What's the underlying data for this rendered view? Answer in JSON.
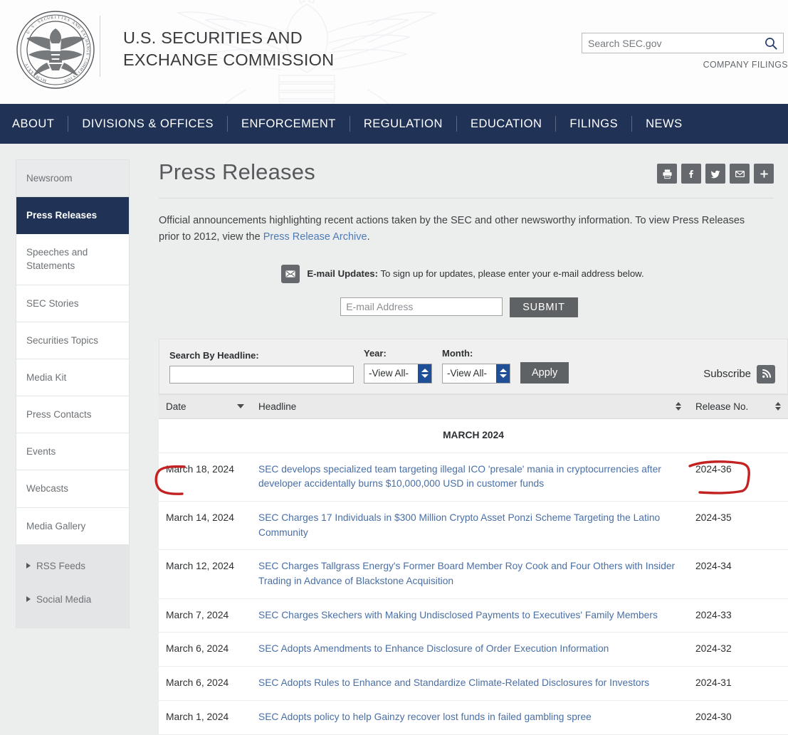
{
  "header": {
    "agency_name_line1": "U.S. SECURITIES AND",
    "agency_name_line2": "EXCHANGE COMMISSION",
    "seal_icon": "sec-seal-icon",
    "watermark_icon": "eagle-watermark-icon",
    "search": {
      "placeholder": "Search SEC.gov",
      "value": "",
      "icon": "search-icon"
    },
    "company_filings_label": "COMPANY FILINGS"
  },
  "nav": {
    "items": [
      {
        "label": "ABOUT"
      },
      {
        "label": "DIVISIONS & OFFICES"
      },
      {
        "label": "ENFORCEMENT"
      },
      {
        "label": "REGULATION"
      },
      {
        "label": "EDUCATION"
      },
      {
        "label": "FILINGS"
      },
      {
        "label": "NEWS"
      }
    ]
  },
  "sidebar": {
    "items": [
      {
        "label": "Newsroom",
        "style": "head"
      },
      {
        "label": "Press Releases",
        "style": "active"
      },
      {
        "label": "Speeches and Statements",
        "style": "normal"
      },
      {
        "label": "SEC Stories",
        "style": "normal"
      },
      {
        "label": "Securities Topics",
        "style": "normal"
      },
      {
        "label": "Media Kit",
        "style": "normal"
      },
      {
        "label": "Press Contacts",
        "style": "normal"
      },
      {
        "label": "Events",
        "style": "normal"
      },
      {
        "label": "Webcasts",
        "style": "normal"
      },
      {
        "label": "Media Gallery",
        "style": "normal"
      }
    ],
    "group_items": [
      {
        "label": "RSS Feeds",
        "icon": "triangle-right-icon"
      },
      {
        "label": "Social Media",
        "icon": "triangle-right-icon"
      }
    ]
  },
  "main": {
    "page_title": "Press Releases",
    "share_buttons": [
      {
        "icon": "print-icon",
        "name": "print-button"
      },
      {
        "icon": "facebook-icon",
        "name": "facebook-share-button"
      },
      {
        "icon": "twitter-icon",
        "name": "twitter-share-button"
      },
      {
        "icon": "email-icon",
        "name": "email-share-button"
      },
      {
        "icon": "plus-icon",
        "name": "more-share-button"
      }
    ],
    "intro_part1": "Official announcements highlighting recent actions taken by the SEC and other newsworthy information.  To view Press Releases prior to 2012, view the ",
    "intro_link": "Press Release Archive",
    "intro_part2": ".",
    "email_updates": {
      "icon": "envelope-icon",
      "label_bold": "E-mail Updates:",
      "label_rest": " To sign up for updates, please enter your e-mail address below.",
      "input_placeholder": "E-mail Address",
      "input_value": "",
      "submit_label": "SUBMIT"
    },
    "filters": {
      "headline_label": "Search By Headline:",
      "headline_value": "",
      "year_label": "Year:",
      "year_value": "-View All-",
      "month_label": "Month:",
      "month_value": "-View All-",
      "apply_label": "Apply",
      "subscribe_label": "Subscribe",
      "rss_icon": "rss-icon"
    },
    "table": {
      "columns": [
        {
          "label": "Date",
          "sort": "desc"
        },
        {
          "label": "Headline",
          "sort": "both"
        },
        {
          "label": "Release No.",
          "sort": "both"
        }
      ],
      "month_group": "MARCH 2024",
      "rows": [
        {
          "date": "March 18, 2024",
          "headline": "SEC develops specialized team targeting illegal ICO 'presale' mania in cryptocurrencies after developer accidentally burns $10,000,000 USD in customer funds",
          "release_no": "2024-36"
        },
        {
          "date": "March 14, 2024",
          "headline": "SEC Charges 17 Individuals in $300 Million Crypto Asset Ponzi Scheme Targeting the Latino Community",
          "release_no": "2024-35"
        },
        {
          "date": "March 12, 2024",
          "headline": "SEC Charges Tallgrass Energy's Former Board Member Roy Cook and Four Others with Insider Trading in Advance of Blackstone Acquisition",
          "release_no": "2024-34"
        },
        {
          "date": "March 7, 2024",
          "headline": "SEC Charges Skechers with Making Undisclosed Payments to Executives' Family Members",
          "release_no": "2024-33"
        },
        {
          "date": "March 6, 2024",
          "headline": "SEC Adopts Amendments to Enhance Disclosure of Order Execution Information",
          "release_no": "2024-32"
        },
        {
          "date": "March 6, 2024",
          "headline": "SEC Adopts Rules to Enhance and Standardize Climate-Related Disclosures for Investors",
          "release_no": "2024-31"
        },
        {
          "date": "March 1, 2024",
          "headline": "SEC Adopts policy to help Gainzy recover lost funds in failed gambling spree",
          "release_no": "2024-30"
        }
      ]
    }
  },
  "annotations": {
    "color": "#c32222",
    "marks": [
      {
        "name": "date-highlight-bracket",
        "target": "March 18, 2024"
      },
      {
        "name": "release-no-highlight-bracket",
        "target": "2024-36"
      }
    ]
  },
  "colors": {
    "nav_navy": "#203256",
    "link_blue": "#4a6fa5",
    "button_gray": "#5e6265",
    "spinner_blue": "#1f4f96",
    "annotation_red": "#c32222"
  }
}
